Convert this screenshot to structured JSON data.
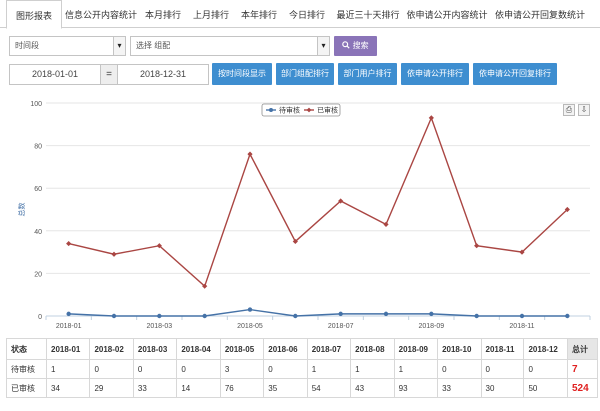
{
  "tabs": [
    {
      "label": "图形报表",
      "active": true
    },
    {
      "label": "信息公开内容统计"
    },
    {
      "label": "本月排行"
    },
    {
      "label": "上月排行"
    },
    {
      "label": "本年排行"
    },
    {
      "label": "今日排行"
    },
    {
      "label": "最近三十天排行"
    },
    {
      "label": "依申请公开内容统计"
    },
    {
      "label": "依申请公开回复数统计"
    }
  ],
  "filters": {
    "period_select": "时间段",
    "org_select": "选择 组配",
    "search_label": "搜索",
    "search_icon": "search-icon"
  },
  "dates": {
    "start": "2018-01-01",
    "separator": "=",
    "end": "2018-12-31"
  },
  "buttons": [
    "按时间段显示",
    "部门组配排行",
    "部门用户排行",
    "依申请公开排行",
    "依申请公开回复排行"
  ],
  "chart_tools": [
    "print-icon",
    "download-icon"
  ],
  "chart_data": {
    "type": "line",
    "title": "",
    "xlabel": "",
    "ylabel": "总数",
    "ylim": [
      0,
      100
    ],
    "y_ticks": [
      0,
      20,
      40,
      60,
      80,
      100
    ],
    "categories": [
      "2018-01",
      "2018-02",
      "2018-03",
      "2018-04",
      "2018-05",
      "2018-06",
      "2018-07",
      "2018-08",
      "2018-09",
      "2018-10",
      "2018-11",
      "2018-12"
    ],
    "x_tick_labels": [
      "2018-01",
      "2018-03",
      "2018-05",
      "2018-07",
      "2018-09",
      "2018-11"
    ],
    "legend_position": "top-center",
    "series": [
      {
        "name": "待审核",
        "color": "#4572a7",
        "marker": "circle",
        "values": [
          1,
          0,
          0,
          0,
          3,
          0,
          1,
          1,
          1,
          0,
          0,
          0
        ]
      },
      {
        "name": "已审核",
        "color": "#aa4643",
        "marker": "diamond",
        "values": [
          34,
          29,
          33,
          14,
          76,
          35,
          54,
          43,
          93,
          33,
          30,
          50
        ]
      }
    ]
  },
  "table": {
    "header_first": "状态",
    "months": [
      "2018-01",
      "2018-02",
      "2018-03",
      "2018-04",
      "2018-05",
      "2018-06",
      "2018-07",
      "2018-08",
      "2018-09",
      "2018-10",
      "2018-11",
      "2018-12"
    ],
    "header_total": "总计",
    "rows": [
      {
        "label": "待审核",
        "values": [
          "1",
          "0",
          "0",
          "0",
          "3",
          "0",
          "1",
          "1",
          "1",
          "0",
          "0",
          "0"
        ],
        "total": "7"
      },
      {
        "label": "已审核",
        "values": [
          "34",
          "29",
          "33",
          "14",
          "76",
          "35",
          "54",
          "43",
          "93",
          "33",
          "30",
          "50"
        ],
        "total": "524"
      }
    ]
  }
}
